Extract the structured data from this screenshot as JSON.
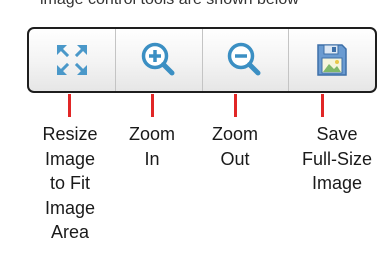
{
  "top_caption": "image control tools are shown below",
  "toolbar": {
    "buttons": [
      {
        "icon": "resize-to-fit-icon",
        "color": "#4a98c9"
      },
      {
        "icon": "zoom-in-icon",
        "color": "#3b8fc3"
      },
      {
        "icon": "zoom-out-icon",
        "color": "#3b8fc3"
      },
      {
        "icon": "save-image-icon",
        "color": "#6a9bd1"
      }
    ]
  },
  "labels": {
    "resize": "Resize\nImage\nto Fit\nImage\nArea",
    "zoom_in": "Zoom\nIn",
    "zoom_out": "Zoom\nOut",
    "save": "Save\nFull-Size\nImage"
  },
  "colors": {
    "connector": "#e12626",
    "icon_blue": "#3b8fc3"
  }
}
